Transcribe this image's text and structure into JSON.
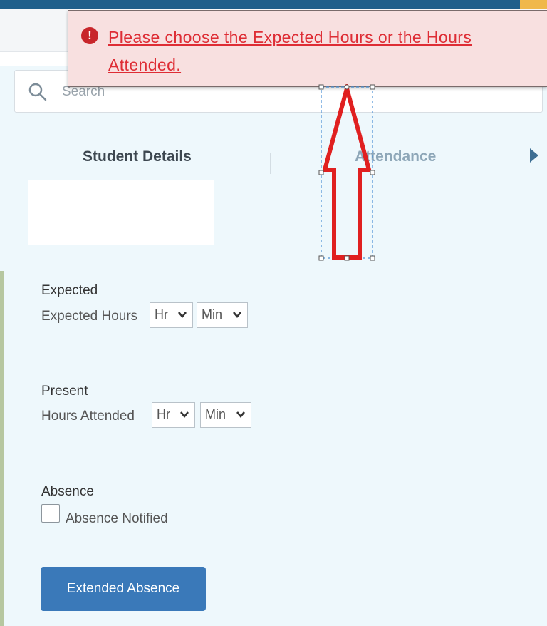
{
  "alert": {
    "message": "Please choose the Expected Hours or the Hours Attended."
  },
  "search": {
    "placeholder": "Search"
  },
  "tabs": [
    {
      "label": "Student Details",
      "active": true
    },
    {
      "label": "Attendance",
      "active": false
    }
  ],
  "expected": {
    "title": "Expected",
    "label": "Expected Hours",
    "hour_select": "Hr",
    "min_select": "Min"
  },
  "present": {
    "title": "Present",
    "label": "Hours Attended",
    "hour_select": "Hr",
    "min_select": "Min"
  },
  "absence": {
    "title": "Absence",
    "checkbox_label": "Absence Notified",
    "checked": false
  },
  "actions": {
    "extended_absence_label": "Extended Absence"
  },
  "colors": {
    "primary_button": "#3a79b9",
    "error_text": "#de2d35",
    "error_background": "#f8e0e0",
    "annotation_arrow": "#e02020",
    "page_background": "#eef8fc"
  },
  "icons": {
    "alert": "exclamation-circle-icon",
    "search": "search-icon",
    "tab_next": "caret-right-icon",
    "select_chevron": "chevron-down-icon"
  }
}
